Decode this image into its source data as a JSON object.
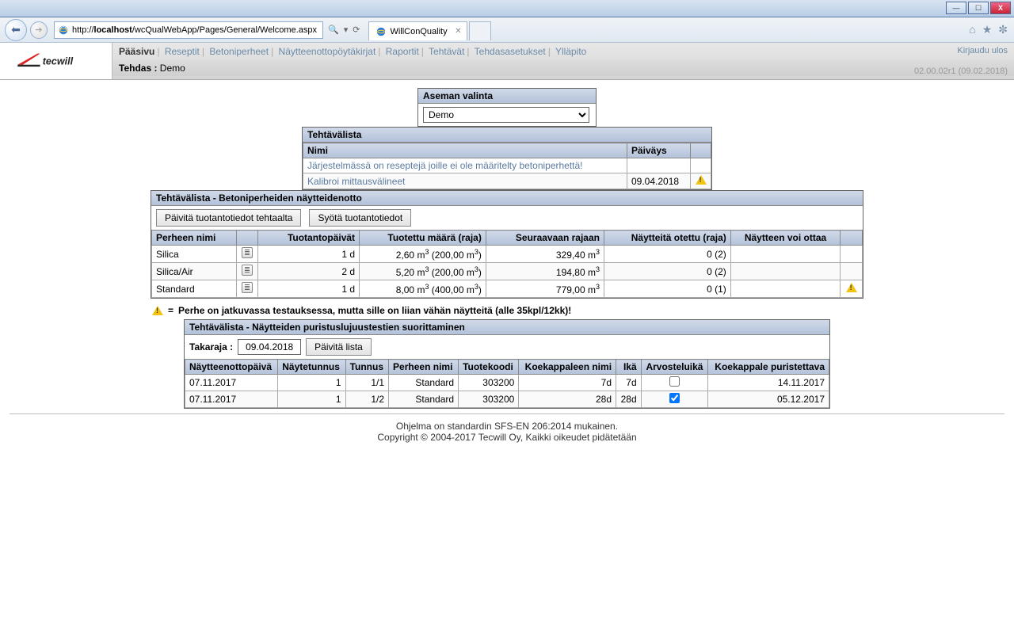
{
  "window": {
    "min": "—",
    "max": "☐",
    "close": "X"
  },
  "browser": {
    "url_host": "localhost",
    "url_prefix": "http://",
    "url_path": "/wcQualWebApp/Pages/General/Welcome.aspx",
    "search_hint": "🔍",
    "refresh": "⟳",
    "tab_title": "WillConQuality",
    "right_icons": [
      "⌂",
      "★",
      "✼"
    ]
  },
  "header": {
    "menu": [
      "Pääsivu",
      "Reseptit",
      "Betoniperheet",
      "Näytteenottopöytäkirjat",
      "Raportit",
      "Tehtävät",
      "Tehdasasetukset",
      "Ylläpito"
    ],
    "active_menu": 0,
    "logout": "Kirjaudu ulos",
    "tehdas_label": "Tehdas :",
    "tehdas_value": "Demo",
    "version": "02.00.02r1 (09.02.2018)"
  },
  "station": {
    "title": "Aseman valinta",
    "selected": "Demo"
  },
  "tasklist": {
    "title": "Tehtävälista",
    "cols": {
      "name": "Nimi",
      "date": "Päiväys"
    },
    "rows": [
      {
        "name": "Järjestelmässä on reseptejä joille ei ole määritelty betoniperhettä!",
        "date": "",
        "warn": false
      },
      {
        "name": "Kalibroi mittausvälineet",
        "date": "09.04.2018",
        "warn": true
      }
    ]
  },
  "sampling": {
    "title": "Tehtävälista - Betoniperheiden näytteidenotto",
    "btn_update": "Päivitä tuotantotiedot tehtaalta",
    "btn_enter": "Syötä tuotantotiedot",
    "cols": {
      "family": "Perheen nimi",
      "icon": "",
      "days": "Tuotantopäivät",
      "produced": "Tuotettu määrä (raja)",
      "tonext": "Seuraavaan rajaan",
      "taken": "Näytteitä otettu (raja)",
      "cantake": "Näytteen voi ottaa",
      "warn": ""
    },
    "rows": [
      {
        "family": "Silica",
        "days": "1 d",
        "prod_val": "2,60 m",
        "prod_lim": "(200,00 m",
        "tonext": "329,40 m",
        "taken": "0 (2)",
        "warn": false
      },
      {
        "family": "Silica/Air",
        "days": "2 d",
        "prod_val": "5,20 m",
        "prod_lim": "(200,00 m",
        "tonext": "194,80 m",
        "taken": "0 (2)",
        "warn": false
      },
      {
        "family": "Standard",
        "days": "1 d",
        "prod_val": "8,00 m",
        "prod_lim": "(400,00 m",
        "tonext": "779,00 m",
        "taken": "0 (1)",
        "warn": true
      }
    ],
    "legend_eq": "=",
    "legend": "Perhe on jatkuvassa testauksessa, mutta sille on liian vähän näytteitä (alle 35kpl/12kk)!"
  },
  "press": {
    "title": "Tehtävälista - Näytteiden puristuslujuustestien suorittaminen",
    "deadline_label": "Takaraja :",
    "deadline": "09.04.2018",
    "btn_update": "Päivitä lista",
    "cols": {
      "date": "Näytteenottopäivä",
      "id": "Näytetunnus",
      "tunnus": "Tunnus",
      "family": "Perheen nimi",
      "product": "Tuotekoodi",
      "piece": "Koekappaleen nimi",
      "age": "Ikä",
      "judge": "Arvosteluikä",
      "must": "Koekappale puristettava"
    },
    "rows": [
      {
        "date": "07.11.2017",
        "id": "1",
        "tunnus": "1/1",
        "family": "Standard",
        "product": "303200",
        "piece": "7d",
        "age": "7d",
        "checked": false,
        "must": "14.11.2017"
      },
      {
        "date": "07.11.2017",
        "id": "1",
        "tunnus": "1/2",
        "family": "Standard",
        "product": "303200",
        "piece": "28d",
        "age": "28d",
        "checked": true,
        "must": "05.12.2017"
      }
    ]
  },
  "footer": {
    "line1": "Ohjelma on standardin SFS-EN 206:2014 mukainen.",
    "line2": "Copyright © 2004-2017 Tecwill Oy, Kaikki oikeudet pidätetään"
  }
}
